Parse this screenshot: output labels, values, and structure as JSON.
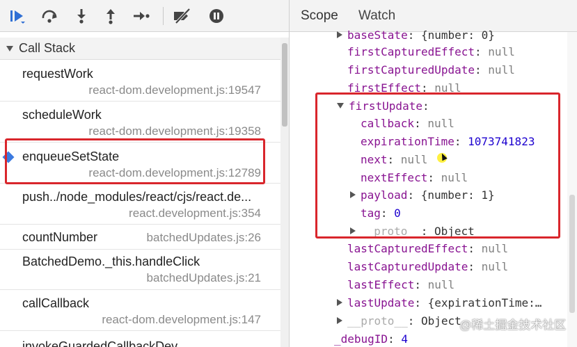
{
  "toolbar": {
    "buttons": [
      "resume-icon",
      "step-over-icon",
      "step-into-icon",
      "step-out-icon",
      "step-icon",
      "deactivate-breakpoints-icon",
      "pause-on-exceptions-icon"
    ]
  },
  "call_stack": {
    "title": "Call Stack",
    "frames": [
      {
        "fn": "requestWork",
        "loc": "react-dom.development.js:19547"
      },
      {
        "fn": "scheduleWork",
        "loc": "react-dom.development.js:19358"
      },
      {
        "fn": "enqueueSetState",
        "loc": "react-dom.development.js:12789"
      },
      {
        "fn": "push../node_modules/react/cjs/react.de...",
        "loc": "react.development.js:354"
      },
      {
        "fn": "countNumber",
        "loc": "batchedUpdates.js:26"
      },
      {
        "fn": "BatchedDemo._this.handleClick",
        "loc": "batchedUpdates.js:21"
      },
      {
        "fn": "callCallback",
        "loc": "react-dom.development.js:147"
      },
      {
        "fn": "invokeGuardedCallbackDev",
        "loc": ""
      }
    ]
  },
  "tabs": [
    "Scope",
    "Watch"
  ],
  "scope": {
    "baseState": {
      "key": "baseState",
      "value": "{number: 0}"
    },
    "firstCapturedEffect": {
      "key": "firstCapturedEffect",
      "value": "null"
    },
    "firstCapturedUpdate": {
      "key": "firstCapturedUpdate",
      "value": "null"
    },
    "firstEffect": {
      "key": "firstEffect",
      "value": "null"
    },
    "firstUpdate": {
      "key": "firstUpdate"
    },
    "callback": {
      "key": "callback",
      "value": "null"
    },
    "expirationTime": {
      "key": "expirationTime",
      "value": "1073741823"
    },
    "next": {
      "key": "next",
      "value": "null"
    },
    "nextEffect": {
      "key": "nextEffect",
      "value": "null"
    },
    "payload": {
      "key": "payload",
      "value": "{number: 1}"
    },
    "tag": {
      "key": "tag",
      "value": "0"
    },
    "proto_inner": {
      "key": "__proto__",
      "value": "Object"
    },
    "lastCapturedEffect": {
      "key": "lastCapturedEffect",
      "value": "null"
    },
    "lastCapturedUpdate": {
      "key": "lastCapturedUpdate",
      "value": "null"
    },
    "lastEffect": {
      "key": "lastEffect",
      "value": "null"
    },
    "lastUpdate": {
      "key": "lastUpdate",
      "value": "{expirationTime:…"
    },
    "proto_outer": {
      "key": "__proto__",
      "value": "Object"
    },
    "debugID": {
      "key": "_debugID",
      "value": "4"
    }
  },
  "watermark": "@稀土掘金技术社区",
  "colors": {
    "highlight": "#d9262c",
    "key": "#881391",
    "number": "#1c00cf",
    "active_frame": "#3b7ae0"
  }
}
